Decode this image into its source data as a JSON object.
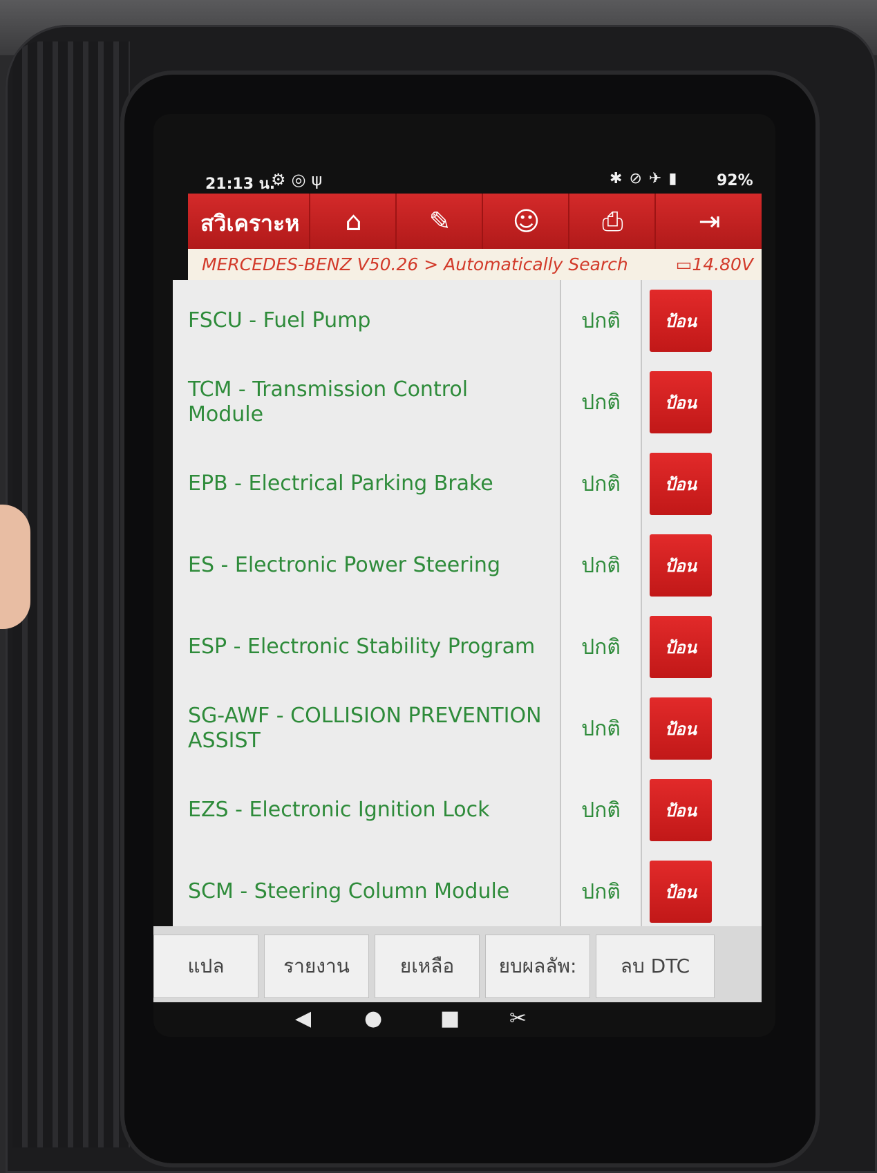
{
  "status_bar": {
    "time": "21:13 น.",
    "left_icons": [
      "gear-icon",
      "aperture-icon",
      "usb-icon"
    ],
    "right_icons": [
      "bluetooth-icon",
      "mute-icon",
      "airplane-icon",
      "battery-icon"
    ],
    "battery": "92%"
  },
  "toolbar": {
    "title": "สวิเคราะห",
    "buttons": [
      "home-icon",
      "edit-icon",
      "user-icon",
      "print-icon",
      "exit-icon"
    ]
  },
  "breadcrumb": {
    "path": "MERCEDES-BENZ V50.26 > Automatically Search",
    "voltage": "14.80V"
  },
  "modules": [
    {
      "name": "FSCU - Fuel Pump",
      "status": "ปกติ",
      "action": "ป้อน"
    },
    {
      "name": "TCM - Transmission Control Module",
      "status": "ปกติ",
      "action": "ป้อน"
    },
    {
      "name": "EPB - Electrical Parking Brake",
      "status": "ปกติ",
      "action": "ป้อน"
    },
    {
      "name": "ES - Electronic Power Steering",
      "status": "ปกติ",
      "action": "ป้อน"
    },
    {
      "name": "ESP - Electronic Stability Program",
      "status": "ปกติ",
      "action": "ป้อน"
    },
    {
      "name": "SG-AWF - COLLISION PREVENTION ASSIST",
      "status": "ปกติ",
      "action": "ป้อน"
    },
    {
      "name": "EZS - Electronic Ignition Lock",
      "status": "ปกติ",
      "action": "ป้อน"
    },
    {
      "name": "SCM - Steering Column Module",
      "status": "ปกติ",
      "action": "ป้อน"
    }
  ],
  "bottom_buttons": [
    "แปล",
    "รายงาน",
    "ยเหลือ",
    "ยบผลลัพ:",
    "ลบ DTC"
  ],
  "colors": {
    "accent": "#c41e1e",
    "text_green": "#2e8b3a"
  }
}
